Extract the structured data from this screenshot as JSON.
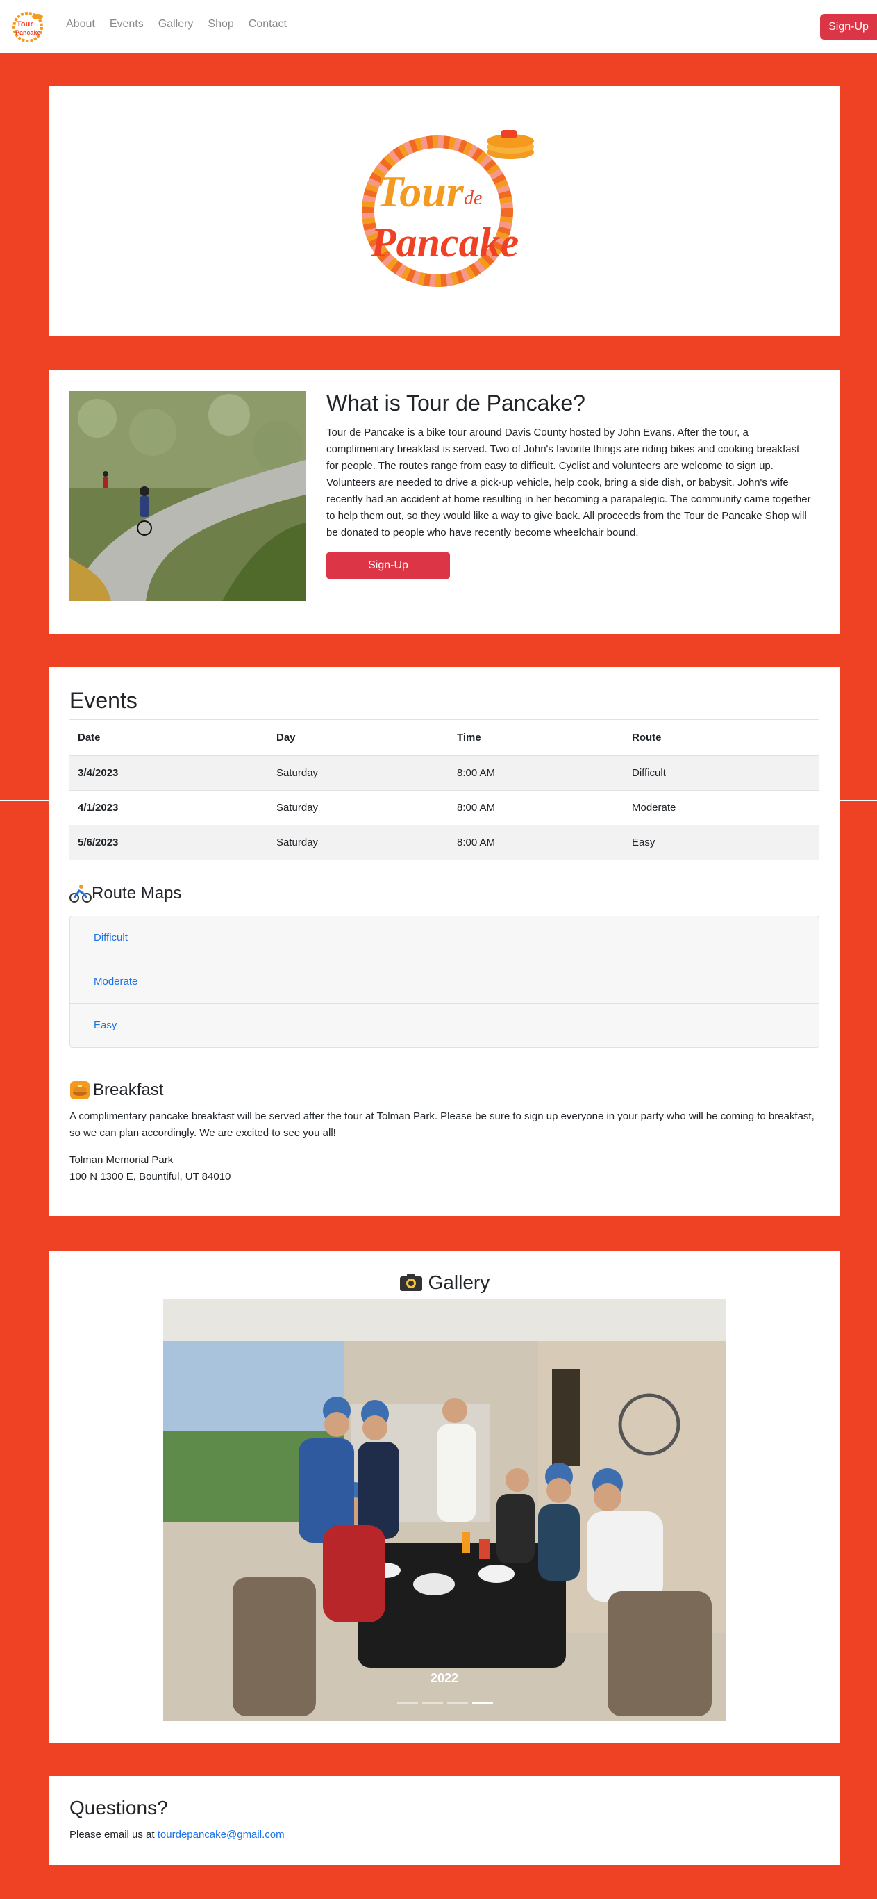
{
  "nav": {
    "links": [
      "About",
      "Events",
      "Gallery",
      "Shop",
      "Contact"
    ],
    "signup_label": "Sign-Up"
  },
  "logo": {
    "line1": "Tour",
    "line_de": "de",
    "line2": "Pancake"
  },
  "about": {
    "title": "What is Tour de Pancake?",
    "body": "Tour de Pancake is a bike tour around Davis County hosted by John Evans. After the tour, a complimentary breakfast is served. Two of John's favorite things are riding bikes and cooking breakfast for people. The routes range from easy to difficult. Cyclist and volunteers are welcome to sign up. Volunteers are needed to drive a pick-up vehicle, help cook, bring a side dish, or babysit. John's wife recently had an accident at home resulting in her becoming a parapalegic. The community came together to help them out, so they would like a way to give back. All proceeds from the Tour de Pancake Shop will be donated to people who have recently become wheelchair bound.",
    "signup_label": "Sign-Up"
  },
  "events": {
    "title": "Events",
    "headers": [
      "Date",
      "Day",
      "Time",
      "Route"
    ],
    "rows": [
      [
        "3/4/2023",
        "Saturday",
        "8:00 AM",
        "Difficult"
      ],
      [
        "4/1/2023",
        "Saturday",
        "8:00 AM",
        "Moderate"
      ],
      [
        "5/6/2023",
        "Saturday",
        "8:00 AM",
        "Easy"
      ]
    ]
  },
  "routes": {
    "title": "Route Maps",
    "icon": "cyclist-icon",
    "items": [
      "Difficult",
      "Moderate",
      "Easy"
    ]
  },
  "breakfast": {
    "title": "Breakfast",
    "icon": "pancakes-icon",
    "text": "A complimentary pancake breakfast will be served after the tour at Tolman Park. Please be sure to sign up everyone in your party who will be coming to breakfast, so we can plan accordingly. We are excited to see you all!",
    "address_line1": "Tolman Memorial Park",
    "address_line2": "100 N 1300 E, Bountiful, UT 84010"
  },
  "gallery": {
    "title": "Gallery",
    "icon": "camera-icon",
    "caption": "2022",
    "slides": 4,
    "active_slide": 4
  },
  "questions": {
    "title": "Questions?",
    "text": "Please email us at",
    "email": "tourdepancake@gmail.com"
  },
  "colors": {
    "brand_red": "#ef4124",
    "button_red": "#dc3545",
    "logo_orange": "#f39a1f",
    "link_blue": "#1a73e8"
  }
}
